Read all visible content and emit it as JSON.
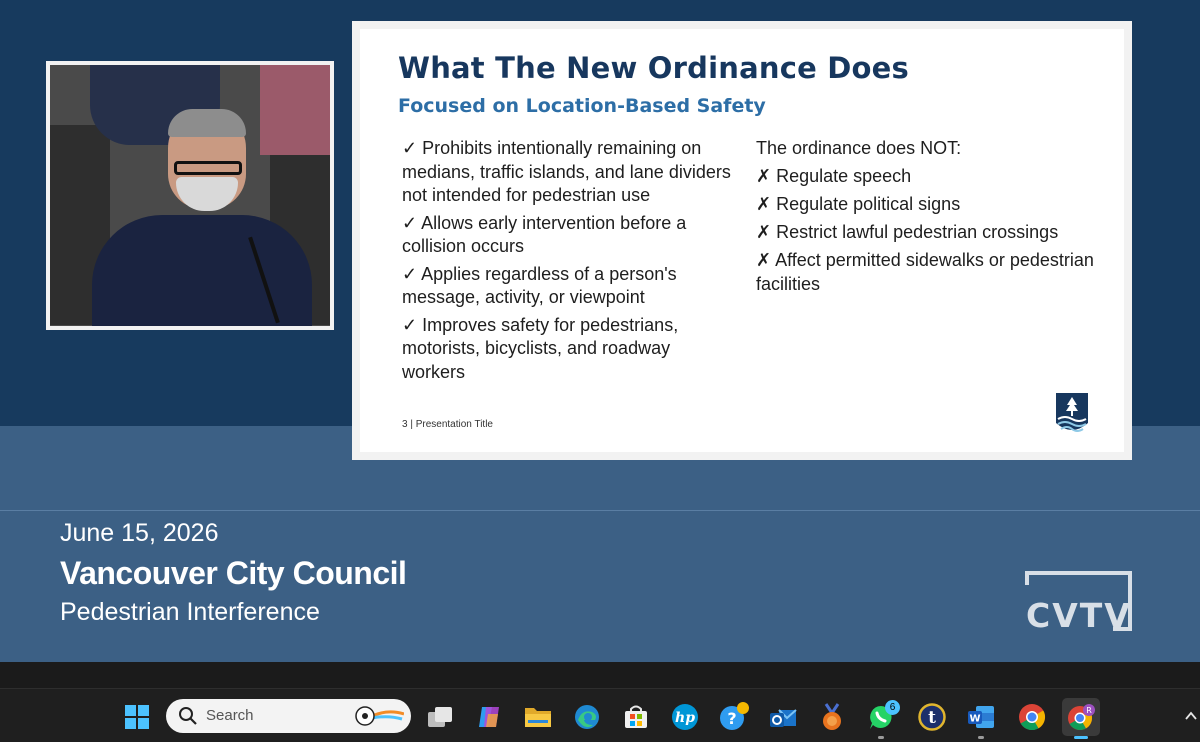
{
  "slide": {
    "title": "What The New Ordinance Does",
    "subtitle": "Focused on Location-Based Safety",
    "left_items": [
      "✓ Prohibits intentionally remaining on medians, traffic islands, and lane dividers not intended for pedestrian use",
      "✓ Allows early intervention before a collision occurs",
      "✓ Applies regardless of a person's message, activity, or viewpoint",
      "✓ Improves safety for pedestrians, motorists, bicyclists, and roadway workers"
    ],
    "right_heading": "The ordinance does NOT:",
    "right_items": [
      "✗ Regulate speech",
      "✗ Regulate political signs",
      "✗ Restrict lawful pedestrian crossings",
      "✗ Affect permitted sidewalks or pedestrian facilities"
    ],
    "footer": "3  |  Presentation Title"
  },
  "caption": {
    "date": "June 15, 2026",
    "title": "Vancouver City Council",
    "topic": "Pedestrian Interference"
  },
  "logo": {
    "text": "CVTV"
  },
  "taskbar": {
    "search_label": "Search",
    "whatsapp_badge": "6",
    "profile_initial": "R"
  },
  "colors": {
    "slide_title": "#17375e",
    "slide_subtitle": "#2d6ea6",
    "video_bg": "#173a5e",
    "lower_third_bg": "#3c6085",
    "taskbar_bg": "#1f1f1f"
  }
}
